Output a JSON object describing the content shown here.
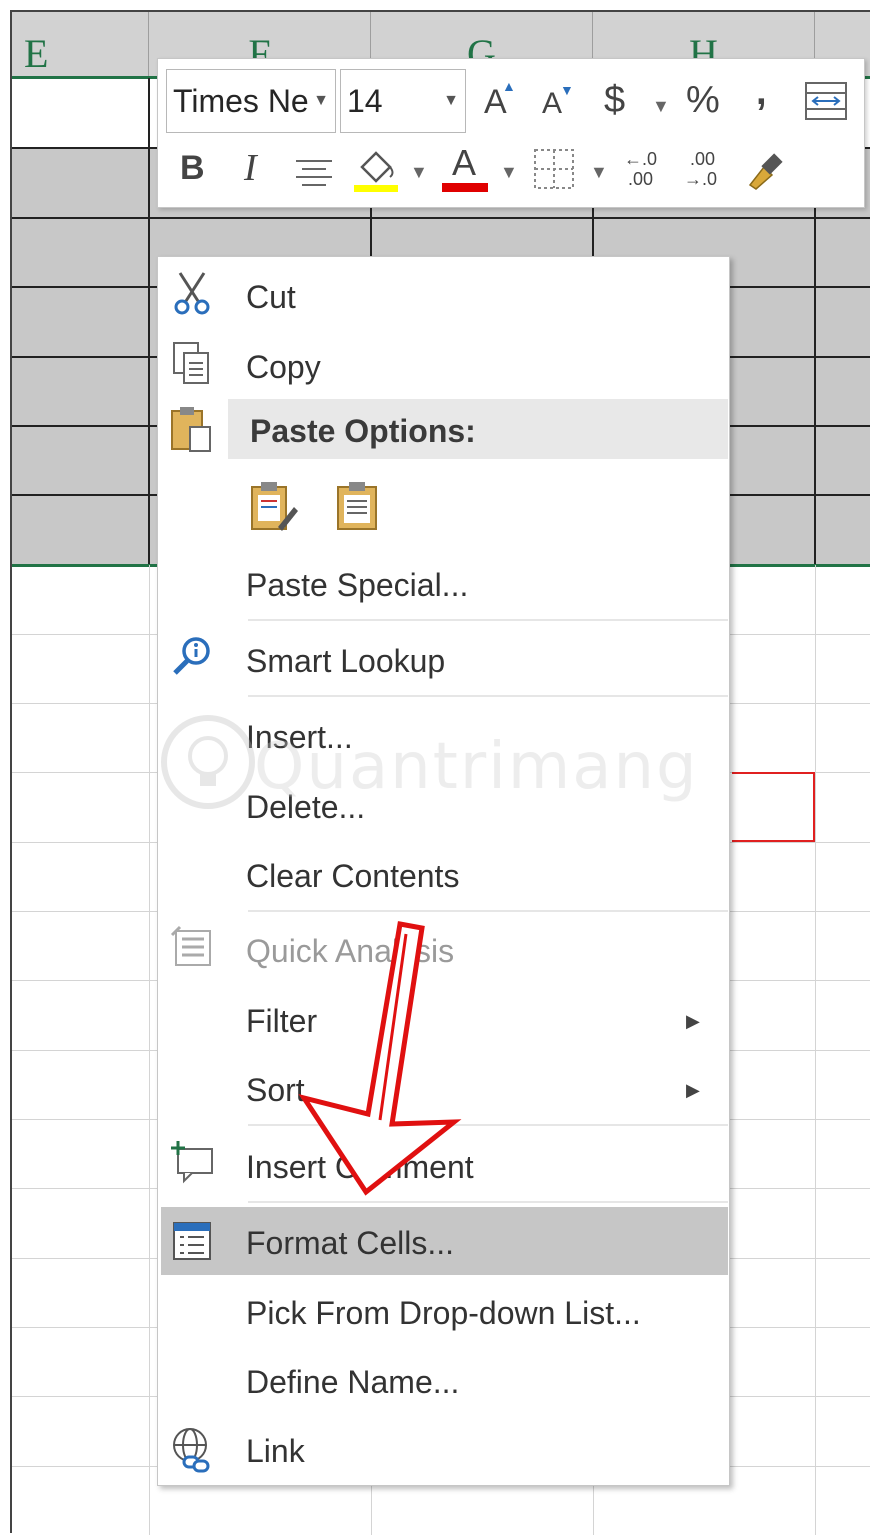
{
  "columns": [
    "E",
    "F",
    "G",
    "H"
  ],
  "mini_toolbar": {
    "font_name": "Times Ne",
    "font_size": "14",
    "grow_font_glyph": "A",
    "shrink_font_glyph": "A",
    "currency_glyph": "$",
    "percent_glyph": "%",
    "comma_glyph": ",",
    "bold_glyph": "B",
    "italic_glyph": "I",
    "font_color_glyph": "A",
    "increase_decimal_top": "←.0",
    "increase_decimal_bottom": ".00",
    "decrease_decimal_top": ".00",
    "decrease_decimal_bottom": "→.0",
    "fill_color": "#ffff00",
    "font_color": "#e00000"
  },
  "context_menu": {
    "cut": "Cut",
    "copy": "Copy",
    "paste_options": "Paste Options:",
    "paste_special": "Paste Special...",
    "smart_lookup": "Smart Lookup",
    "insert": "Insert...",
    "delete": "Delete...",
    "clear_contents": "Clear Contents",
    "quick_analysis": "Quick Analysis",
    "filter": "Filter",
    "sort": "Sort",
    "insert_comment": "Insert Comment",
    "format_cells": "Format Cells...",
    "pick_from_list": "Pick From Drop-down List...",
    "define_name": "Define Name...",
    "link": "Link",
    "submenu_glyph": "▶"
  },
  "watermark": "Quantrimang",
  "colors": {
    "accent_green": "#217346",
    "highlight": "#c6c6c6",
    "annotation_red": "#e01010"
  }
}
